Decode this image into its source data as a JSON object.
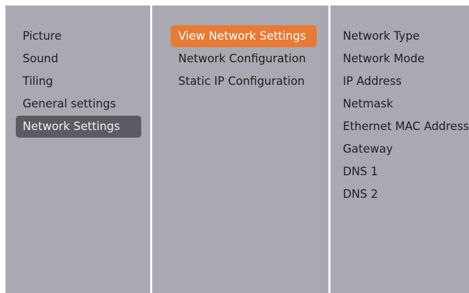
{
  "colors": {
    "panel_background": "#a9a9b1",
    "divider": "#ffffff",
    "selected_category_background": "#5b5b62",
    "focused_item_background": "#e87a33",
    "text": "#1e1e1e"
  },
  "menu": {
    "categories": [
      {
        "label": "Picture",
        "selected": false
      },
      {
        "label": "Sound",
        "selected": false
      },
      {
        "label": "Tiling",
        "selected": false
      },
      {
        "label": "General settings",
        "selected": false
      },
      {
        "label": "Network Settings",
        "selected": true
      }
    ],
    "submenu": [
      {
        "label": "View Network Settings",
        "focused": true
      },
      {
        "label": "Network Configuration",
        "focused": false
      },
      {
        "label": "Static IP Configuration",
        "focused": false
      }
    ],
    "details": [
      {
        "label": "Network Type"
      },
      {
        "label": "Network Mode"
      },
      {
        "label": "IP Address"
      },
      {
        "label": "Netmask"
      },
      {
        "label": "Ethernet MAC Address"
      },
      {
        "label": "Gateway"
      },
      {
        "label": "DNS 1"
      },
      {
        "label": "DNS 2"
      }
    ]
  }
}
